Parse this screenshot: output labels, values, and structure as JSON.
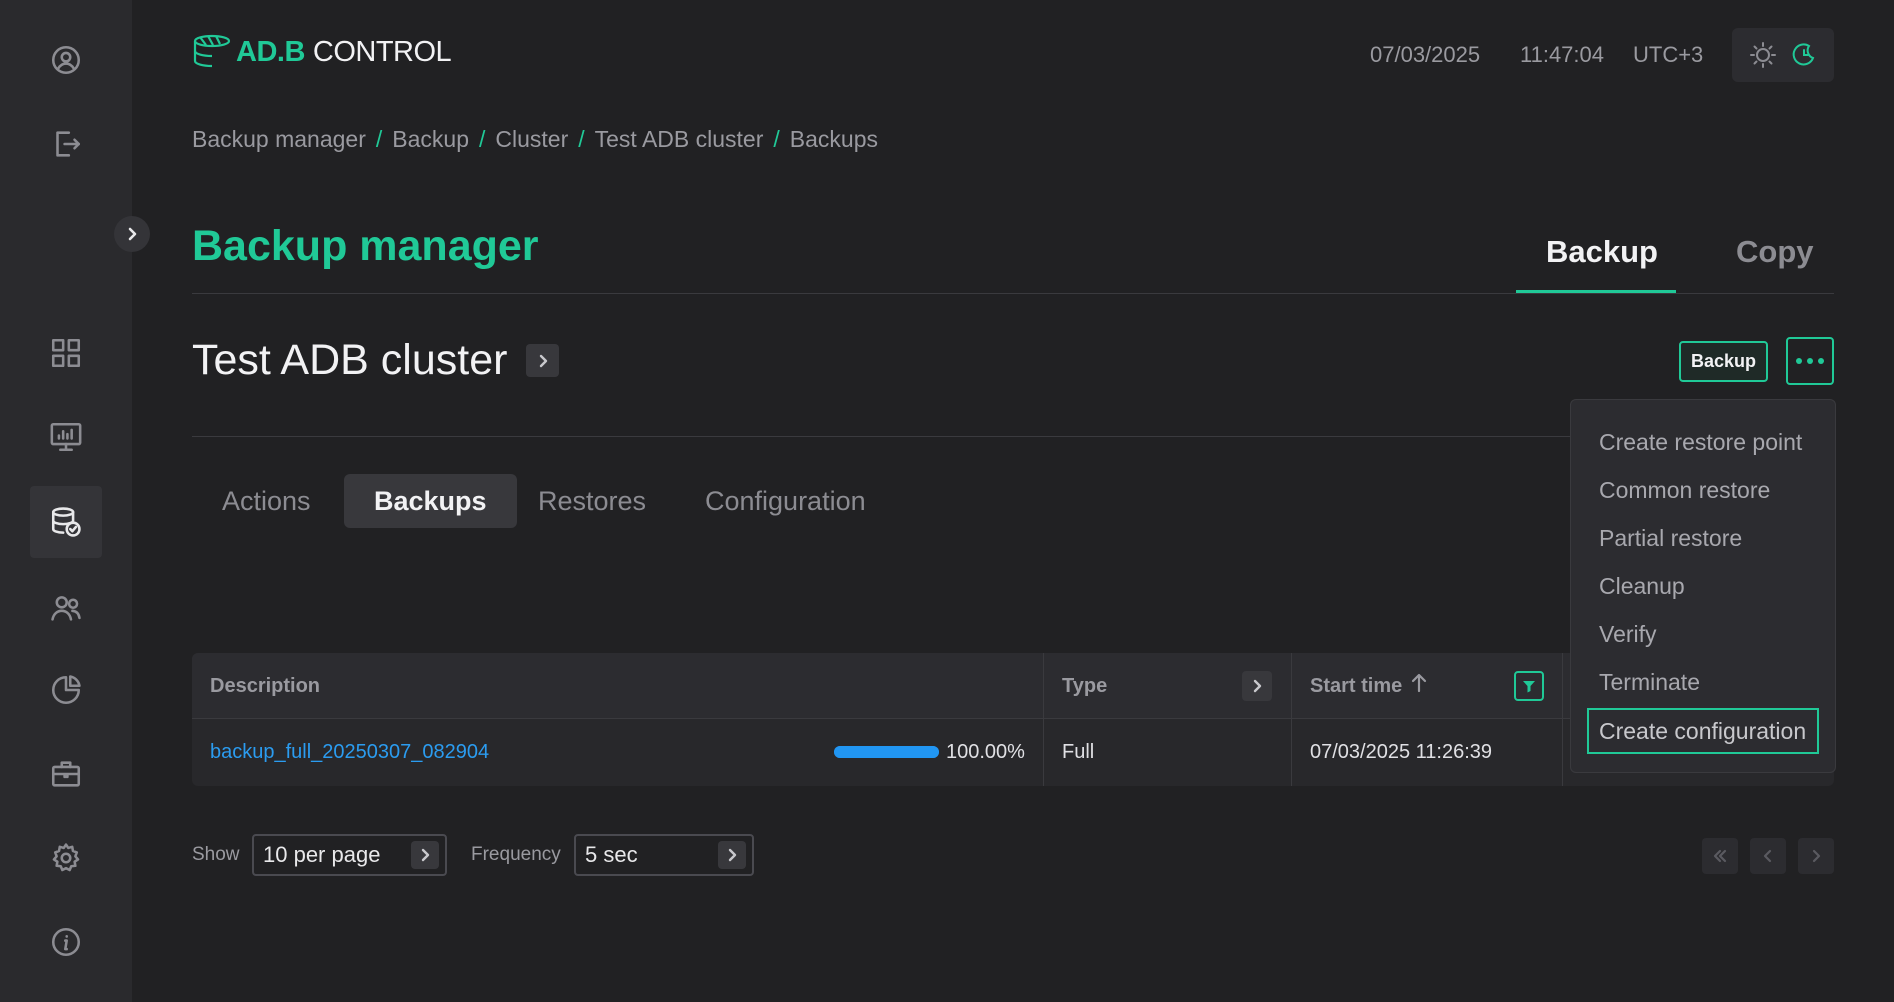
{
  "header": {
    "logo_prefix": "AD.B",
    "logo_suffix": "CONTROL",
    "date": "07/03/2025",
    "time": "11:47:04",
    "timezone": "UTC+3"
  },
  "breadcrumb": [
    "Backup manager",
    "Backup",
    "Cluster",
    "Test ADB cluster",
    "Backups"
  ],
  "breadcrumb_separator": "/",
  "page": {
    "title": "Backup manager",
    "tabs": [
      {
        "label": "Backup",
        "active": true
      },
      {
        "label": "Copy",
        "active": false
      }
    ]
  },
  "cluster": {
    "name": "Test ADB cluster",
    "backup_button": "Backup"
  },
  "sub_tabs": [
    {
      "label": "Actions",
      "active": false
    },
    {
      "label": "Backups",
      "active": true
    },
    {
      "label": "Restores",
      "active": false
    },
    {
      "label": "Configuration",
      "active": false
    }
  ],
  "menu": {
    "items": [
      "Create restore point",
      "Common restore",
      "Partial restore",
      "Cleanup",
      "Verify",
      "Terminate",
      "Create configuration"
    ],
    "focused_index": 6
  },
  "table": {
    "columns": [
      "Description",
      "Type",
      "Start time"
    ],
    "rows": [
      {
        "description": "backup_full_20250307_082904",
        "progress": 1.0,
        "progress_label": "100.00%",
        "type": "Full",
        "start_time": "07/03/2025 11:26:39"
      }
    ]
  },
  "footer": {
    "show_label": "Show",
    "per_page": "10 per page",
    "frequency_label": "Frequency",
    "frequency": "5 sec"
  },
  "icons": {
    "sidebar": [
      "user-circle-icon",
      "logout-icon",
      "dashboard-grid-icon",
      "monitor-chart-icon",
      "database-check-icon",
      "users-icon",
      "pie-chart-icon",
      "briefcase-icon",
      "gear-icon",
      "info-icon"
    ],
    "accent_color": "#20c997",
    "link_color": "#2b9cf0",
    "progress_color": "#2196f3"
  }
}
